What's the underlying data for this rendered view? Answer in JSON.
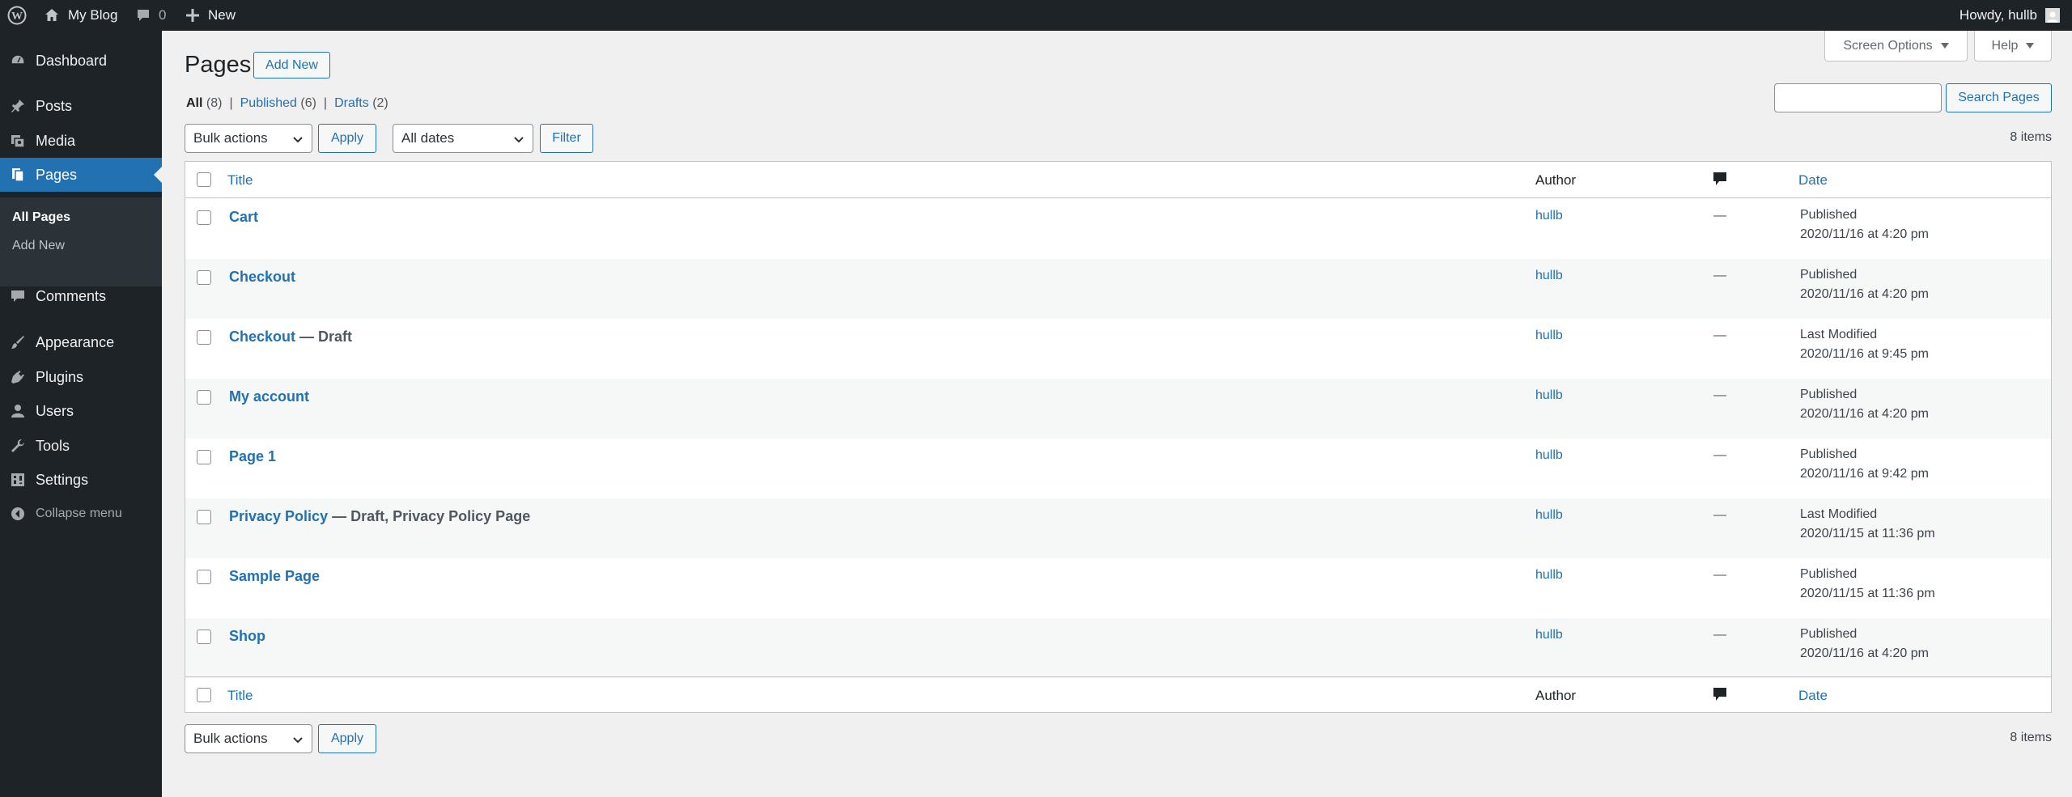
{
  "adminbar": {
    "site_name": "My Blog",
    "comments_count": "0",
    "new_label": "New",
    "howdy": "Howdy, hullb"
  },
  "sidebar": {
    "items": [
      {
        "label": "Dashboard",
        "icon": "dashboard-icon"
      },
      {
        "label": "Posts",
        "icon": "pin-icon"
      },
      {
        "label": "Media",
        "icon": "media-icon"
      },
      {
        "label": "Pages",
        "icon": "pages-icon"
      },
      {
        "label": "Comments",
        "icon": "comment-icon"
      },
      {
        "label": "Appearance",
        "icon": "brush-icon"
      },
      {
        "label": "Plugins",
        "icon": "plug-icon"
      },
      {
        "label": "Users",
        "icon": "user-icon"
      },
      {
        "label": "Tools",
        "icon": "wrench-icon"
      },
      {
        "label": "Settings",
        "icon": "settings-icon"
      },
      {
        "label": "Collapse menu",
        "icon": "collapse-icon"
      }
    ],
    "submenu": [
      "All Pages",
      "Add New"
    ]
  },
  "header": {
    "title": "Pages",
    "add_new": "Add New",
    "screen_options": "Screen Options",
    "help": "Help"
  },
  "filters": {
    "all_label": "All",
    "all_count": "(8)",
    "published_label": "Published",
    "published_count": "(6)",
    "drafts_label": "Drafts",
    "drafts_count": "(2)",
    "separator": "|"
  },
  "search": {
    "button": "Search Pages",
    "value": ""
  },
  "tablenav": {
    "bulk_actions": "Bulk actions",
    "apply": "Apply",
    "all_dates": "All dates",
    "filter": "Filter",
    "items_count": "8 items"
  },
  "table": {
    "columns": {
      "title": "Title",
      "author": "Author",
      "date": "Date"
    },
    "rows": [
      {
        "title": "Cart",
        "state": "",
        "author": "hullb",
        "comments": "—",
        "status": "Published",
        "date": "2020/11/16 at 4:20 pm"
      },
      {
        "title": "Checkout",
        "state": "",
        "author": "hullb",
        "comments": "—",
        "status": "Published",
        "date": "2020/11/16 at 4:20 pm"
      },
      {
        "title": "Checkout",
        "state": " — Draft",
        "author": "hullb",
        "comments": "—",
        "status": "Last Modified",
        "date": "2020/11/16 at 9:45 pm"
      },
      {
        "title": "My account",
        "state": "",
        "author": "hullb",
        "comments": "—",
        "status": "Published",
        "date": "2020/11/16 at 4:20 pm"
      },
      {
        "title": "Page 1",
        "state": "",
        "author": "hullb",
        "comments": "—",
        "status": "Published",
        "date": "2020/11/16 at 9:42 pm"
      },
      {
        "title": "Privacy Policy",
        "state": " — Draft, Privacy Policy Page",
        "author": "hullb",
        "comments": "—",
        "status": "Last Modified",
        "date": "2020/11/15 at 11:36 pm"
      },
      {
        "title": "Sample Page",
        "state": "",
        "author": "hullb",
        "comments": "—",
        "status": "Published",
        "date": "2020/11/15 at 11:36 pm"
      },
      {
        "title": "Shop",
        "state": "",
        "author": "hullb",
        "comments": "—",
        "status": "Published",
        "date": "2020/11/16 at 4:20 pm"
      }
    ]
  },
  "colors": {
    "accent": "#2271b1",
    "adminbar": "#1d2327",
    "background": "#f0f0f1"
  }
}
